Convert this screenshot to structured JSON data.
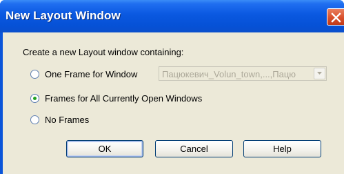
{
  "window": {
    "title": "New Layout Window",
    "close_icon": "close-icon"
  },
  "dialog": {
    "prompt": "Create a new Layout window containing:",
    "options": [
      {
        "label": "One Frame for Window",
        "selected": false
      },
      {
        "label": "Frames for All Currently Open Windows",
        "selected": true
      },
      {
        "label": "No Frames",
        "selected": false
      }
    ],
    "window_select": {
      "value": "Пацюкевич_Volun_town,...,Пацю",
      "enabled": false
    }
  },
  "buttons": {
    "ok": "OK",
    "cancel": "Cancel",
    "help": "Help"
  },
  "colors": {
    "titlebar": "#0a58e0",
    "dialog_bg": "#ece9d8",
    "close_button": "#d9502c",
    "radio_dot": "#21a121"
  }
}
